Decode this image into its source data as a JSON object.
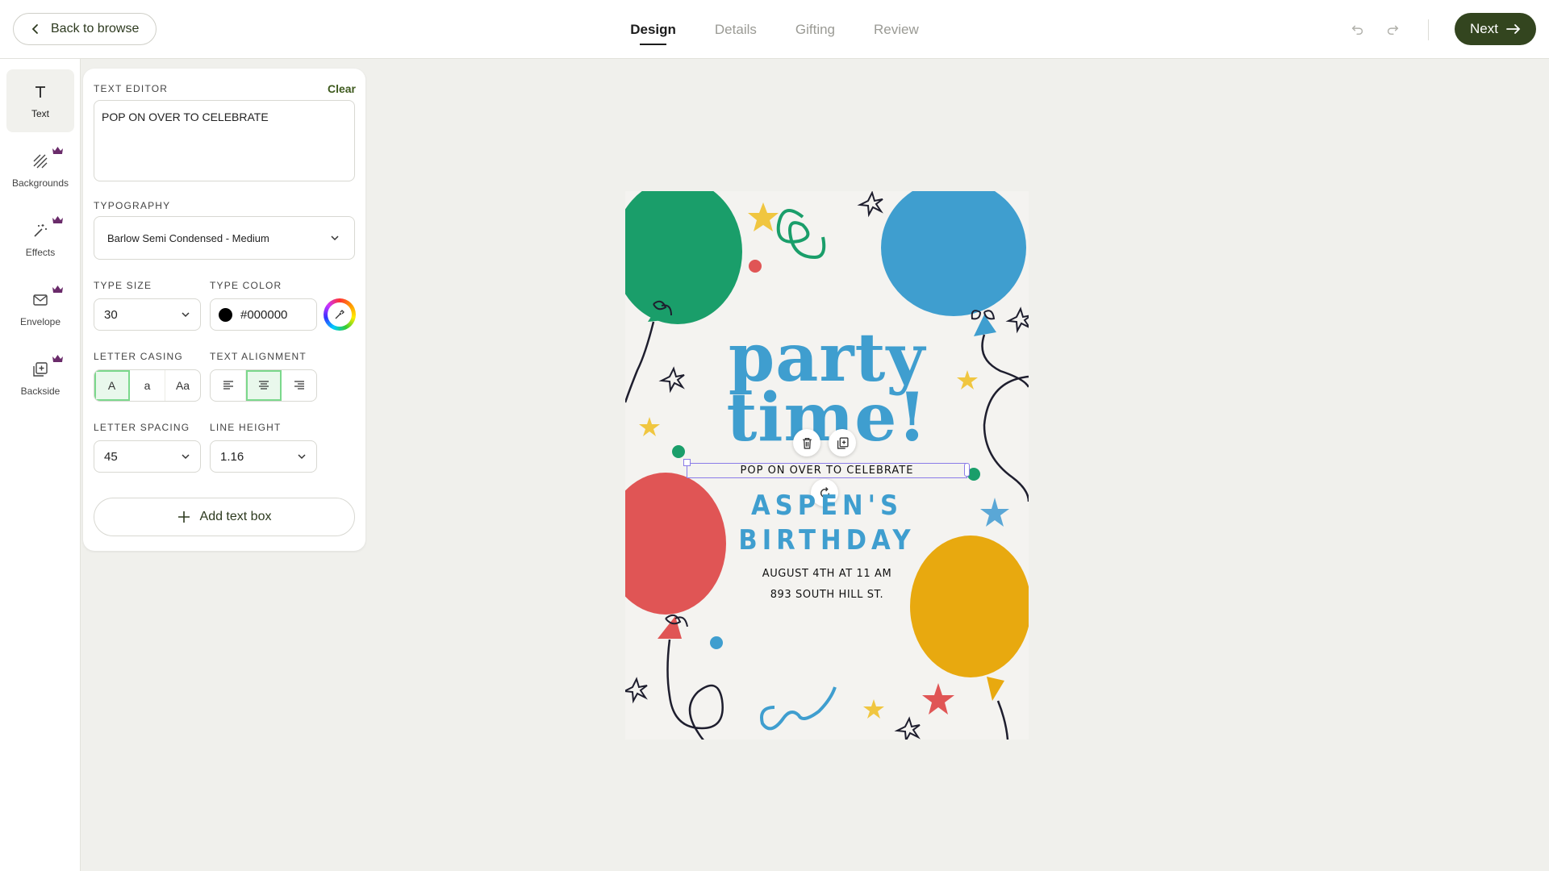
{
  "header": {
    "back_label": "Back to browse",
    "steps": [
      {
        "label": "Design",
        "active": true
      },
      {
        "label": "Details",
        "active": false
      },
      {
        "label": "Gifting",
        "active": false
      },
      {
        "label": "Review",
        "active": false
      }
    ],
    "next_label": "Next"
  },
  "rail": {
    "items": [
      {
        "label": "Text",
        "icon": "text-icon",
        "premium": false,
        "active": true
      },
      {
        "label": "Backgrounds",
        "icon": "backgrounds-icon",
        "premium": true
      },
      {
        "label": "Effects",
        "icon": "magic-wand-icon",
        "premium": true
      },
      {
        "label": "Envelope",
        "icon": "envelope-icon",
        "premium": true
      },
      {
        "label": "Backside",
        "icon": "backside-icon",
        "premium": true
      }
    ]
  },
  "panel": {
    "text_editor_label": "TEXT EDITOR",
    "clear_label": "Clear",
    "text_value": "POP ON OVER TO CELEBRATE",
    "typography_label": "TYPOGRAPHY",
    "font_value": "Barlow Semi Condensed - Medium",
    "type_size_label": "TYPE SIZE",
    "type_size_value": "30",
    "type_color_label": "TYPE COLOR",
    "type_color_value": "#000000",
    "letter_casing_label": "LETTER CASING",
    "casing_options": [
      "A",
      "a",
      "Aa"
    ],
    "casing_selected": "A",
    "text_alignment_label": "TEXT ALIGNMENT",
    "alignment_selected": "center",
    "letter_spacing_label": "LETTER SPACING",
    "letter_spacing_value": "45",
    "line_height_label": "LINE HEIGHT",
    "line_height_value": "1.16",
    "add_text_label": "Add text box"
  },
  "card": {
    "headline_1": "party",
    "headline_2": "time!",
    "selected_text": "POP ON OVER TO CELEBRATE",
    "name_1": "ASPEN'S",
    "name_2": "BIRTHDAY",
    "detail_1": "AUGUST 4TH AT 11 AM",
    "detail_2": "893 SOUTH HILL ST."
  },
  "colors": {
    "accent": "#33451f",
    "balloon_green": "#1a9e6a",
    "balloon_blue": "#3f9ecf",
    "balloon_red": "#e05555",
    "balloon_yellow": "#e8a90f",
    "headline_blue": "#3f9ecf",
    "selection": "#8a7be8"
  }
}
